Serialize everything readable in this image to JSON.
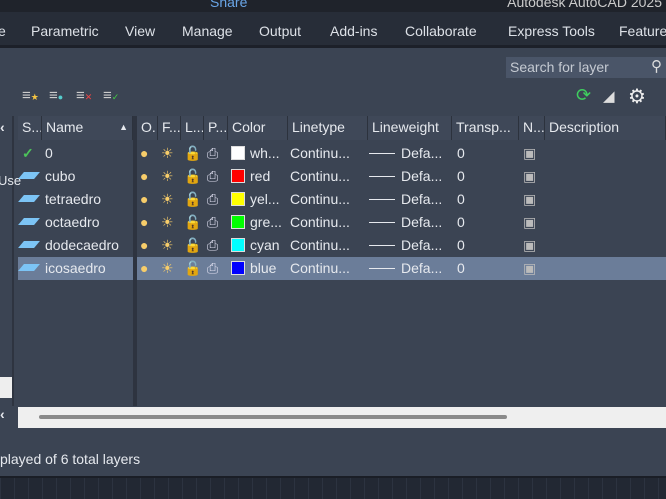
{
  "title": "Autodesk AutoCAD 2025",
  "share_label": "Share",
  "ribbon_tabs": [
    "e",
    "Parametric",
    "View",
    "Manage",
    "Output",
    "Add-ins",
    "Collaborate",
    "Express Tools",
    "Feature"
  ],
  "search": {
    "placeholder": "Search for layer"
  },
  "columns": {
    "status": "S...",
    "name": "Name",
    "on": "O...",
    "freeze": "F...",
    "lock": "L...",
    "plot": "P...",
    "color": "Color",
    "linetype": "Linetype",
    "lineweight": "Lineweight",
    "transparency": "Transp...",
    "new_vp": "N...",
    "description": "Description"
  },
  "left_pane_label": "Use",
  "layers": [
    {
      "name": "0",
      "color_name": "wh...",
      "color": "#ffffff",
      "linetype": "Continu...",
      "lineweight": "Defa...",
      "transparency": "0",
      "current": true
    },
    {
      "name": "cubo",
      "color_name": "red",
      "color": "#ff0000",
      "linetype": "Continu...",
      "lineweight": "Defa...",
      "transparency": "0"
    },
    {
      "name": "tetraedro",
      "color_name": "yel...",
      "color": "#ffff00",
      "linetype": "Continu...",
      "lineweight": "Defa...",
      "transparency": "0"
    },
    {
      "name": "octaedro",
      "color_name": "gre...",
      "color": "#00ff00",
      "linetype": "Continu...",
      "lineweight": "Defa...",
      "transparency": "0"
    },
    {
      "name": "dodecaedro",
      "color_name": "cyan",
      "color": "#00ffff",
      "linetype": "Continu...",
      "lineweight": "Defa...",
      "transparency": "0"
    },
    {
      "name": "icosaedro",
      "color_name": "blue",
      "color": "#0000ff",
      "linetype": "Continu...",
      "lineweight": "Defa...",
      "transparency": "0",
      "selected": true
    }
  ],
  "status_text": "played of 6 total layers"
}
